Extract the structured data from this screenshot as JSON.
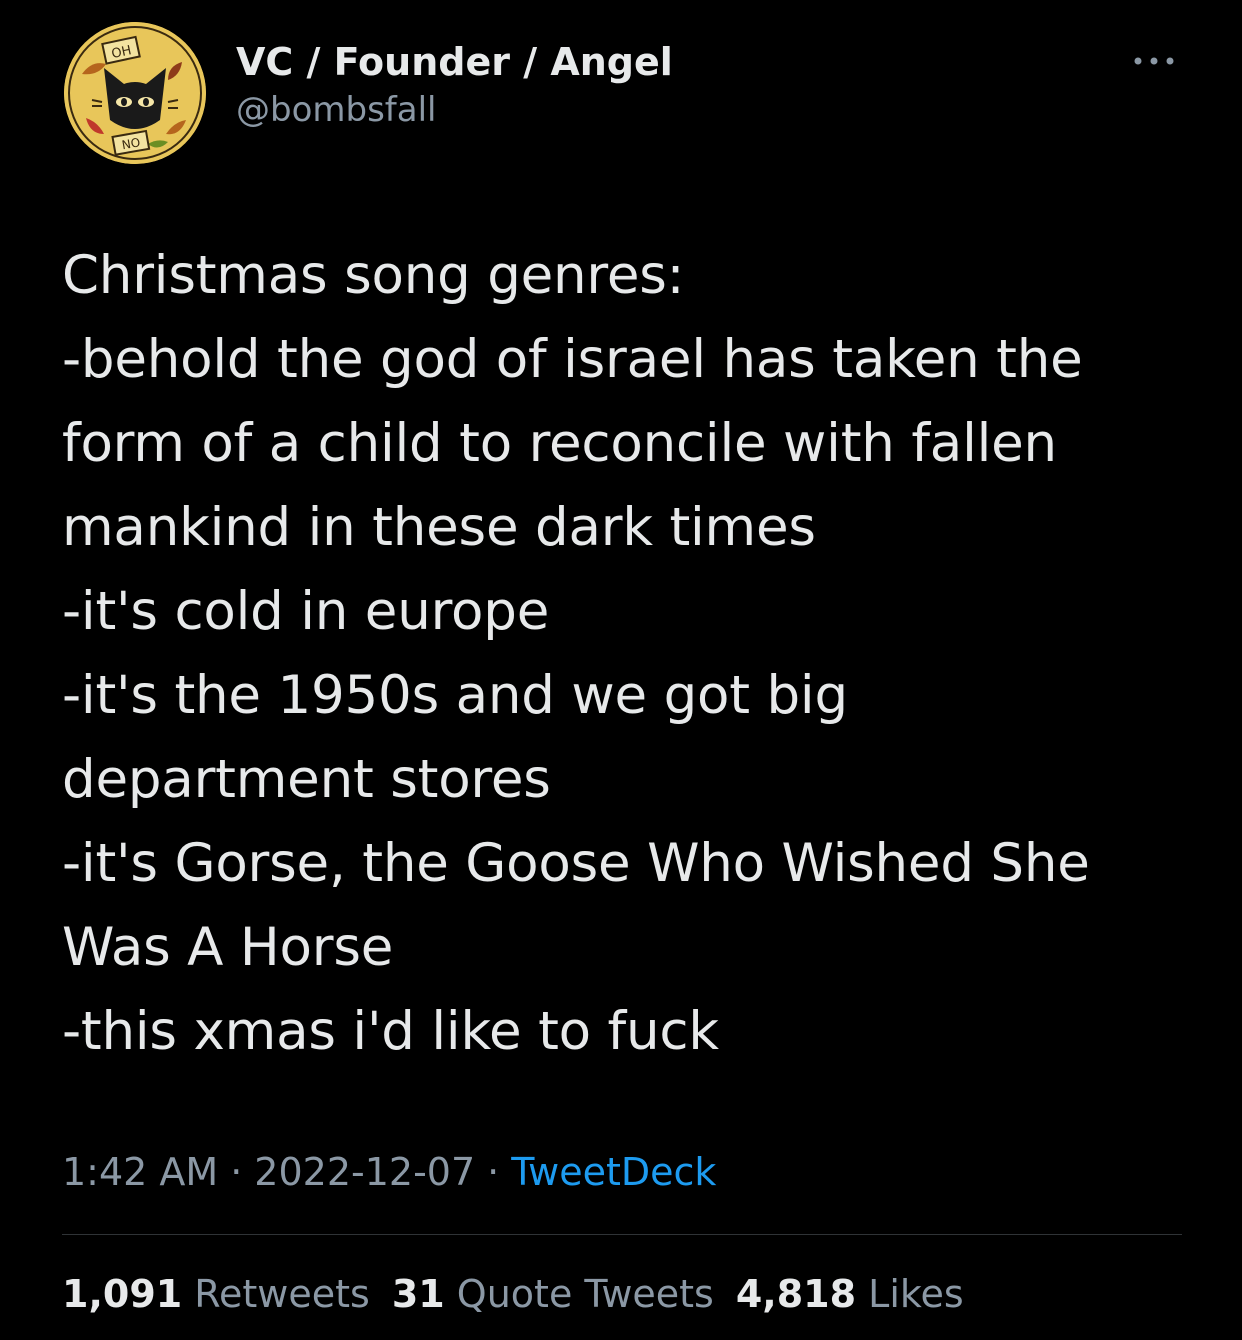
{
  "author": {
    "display_name": "VC / Founder / Angel",
    "handle": "@bombsfall",
    "avatar_icon": "cat-emblem-avatar-icon",
    "avatar_text_top": "OH",
    "avatar_text_bottom": "NO"
  },
  "menu": {
    "icon": "more-options-icon"
  },
  "tweet": {
    "text": "Christmas song genres:\n-behold the god of israel has taken the\nform of a child to reconcile with fallen\nmankind in these dark times\n-it's cold in europe\n-it's the 1950s and we got big\ndepartment stores\n-it's Gorse, the Goose Who Wished She\nWas A Horse\n-this xmas i'd like to fuck"
  },
  "meta": {
    "time": "1:42 AM",
    "separator": "·",
    "date": "2022-12-07",
    "source": "TweetDeck"
  },
  "stats": {
    "retweets_count": "1,091",
    "retweets_label": "Retweets",
    "quotes_count": "31",
    "quotes_label": "Quote Tweets",
    "likes_count": "4,818",
    "likes_label": "Likes"
  },
  "colors": {
    "background": "#000000",
    "text_primary": "#e7e9ea",
    "text_secondary": "#8b98a5",
    "link": "#1d9bf0",
    "divider": "#2f3336",
    "avatar_bg": "#e8c65a"
  }
}
